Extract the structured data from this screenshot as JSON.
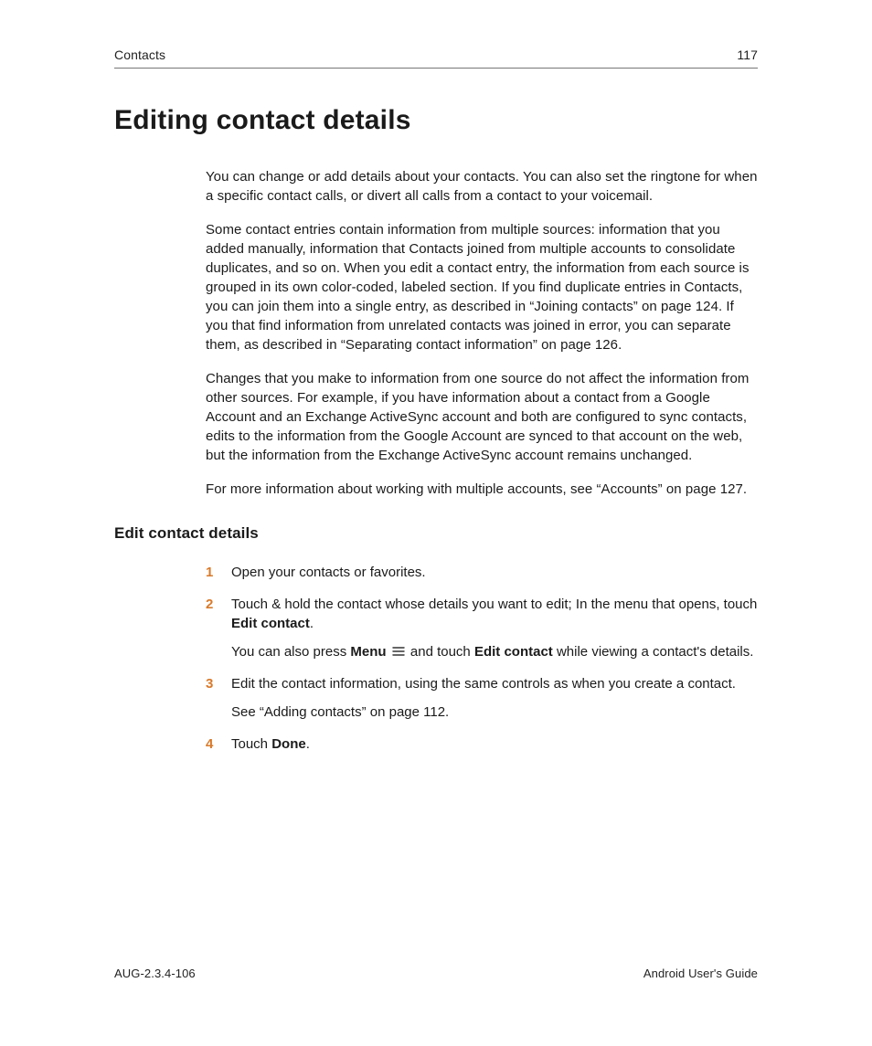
{
  "header": {
    "section": "Contacts",
    "page_number": "117"
  },
  "title": "Editing contact details",
  "paragraphs": {
    "p1": "You can change or add details about your contacts. You can also set the ringtone for when a specific contact calls, or divert all calls from a contact to your voicemail.",
    "p2": "Some contact entries contain information from multiple sources: information that you added manually, information that Contacts joined from multiple accounts to consolidate duplicates, and so on. When you edit a contact entry, the information from each source is grouped in its own color-coded, labeled section. If you find duplicate entries in Contacts, you can join them into a single entry, as described in “Joining contacts” on page 124. If you that find information from unrelated contacts was joined in error, you can separate them, as described in “Separating contact information” on page 126.",
    "p3": "Changes that you make to information from one source do not affect the information from other sources. For example, if you have information about a contact from a Google Account and an Exchange ActiveSync account and both are configured to sync contacts, edits to the information from the Google Account are synced to that account on the web, but the information from the Exchange ActiveSync account remains unchanged.",
    "p4": "For more information about working with multiple accounts, see “Accounts” on page 127."
  },
  "subheading": "Edit contact details",
  "steps": {
    "n1": "1",
    "s1": "Open your contacts or favorites.",
    "n2": "2",
    "s2a_pre": "Touch & hold the contact whose details you want to edit; In the menu that opens, touch ",
    "s2a_bold": "Edit contact",
    "s2a_post": ".",
    "s2b_pre": "You can also press ",
    "s2b_menu": "Menu",
    "s2b_mid": " and touch ",
    "s2b_bold": "Edit contact",
    "s2b_post": " while viewing a contact's details.",
    "n3": "3",
    "s3a": "Edit the contact information, using the same controls as when you create a contact.",
    "s3b": "See “Adding contacts” on page 112.",
    "n4": "4",
    "s4_pre": "Touch ",
    "s4_bold": "Done",
    "s4_post": "."
  },
  "footer": {
    "left": "AUG-2.3.4-106",
    "right": "Android User's Guide"
  }
}
